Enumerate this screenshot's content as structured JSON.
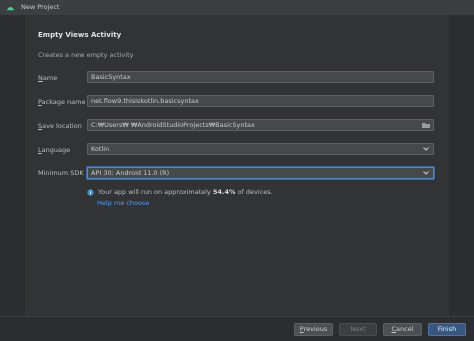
{
  "window": {
    "title": "New Project"
  },
  "header": {
    "title": "Empty Views Activity",
    "description": "Creates a new empty activity"
  },
  "form": {
    "name": {
      "label_ul": "N",
      "label_rest": "ame",
      "value": "BasicSyntax"
    },
    "package": {
      "label_ul": "P",
      "label_rest": "ackage name",
      "value": "net.flow9.thisiskotlin.basicsyntax"
    },
    "save_location": {
      "label_ul": "S",
      "label_rest": "ave location",
      "value": "C:₩Users₩       ₩AndroidStudioProjects₩BasicSyntax"
    },
    "language": {
      "label_ul": "L",
      "label_rest": "anguage",
      "value": "Kotlin"
    },
    "min_sdk": {
      "label": "Minimum SDK",
      "value": "API 30: Android 11.0 (R)"
    }
  },
  "info": {
    "text_before": "Your app will run on approximately ",
    "percent": "54.4%",
    "text_after": " of devices.",
    "help_link": "Help me choose"
  },
  "footer": {
    "previous_ul": "P",
    "previous_rest": "revious",
    "next": "Next",
    "cancel_ul": "C",
    "cancel_rest": "ancel",
    "finish": "Finish"
  },
  "colors": {
    "accent": "#589df6",
    "primary_button": "#365880",
    "android_green": "#3ddc84"
  }
}
